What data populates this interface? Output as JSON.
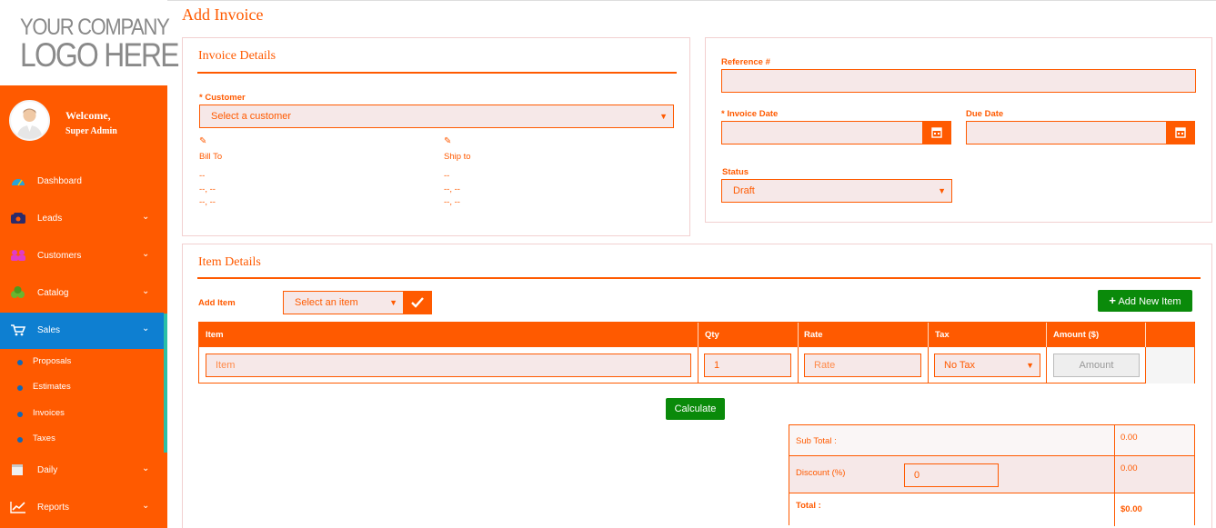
{
  "logo": {
    "line1": "YOUR COMPANY",
    "line2": "LOGO HERE"
  },
  "profile": {
    "welcome": "Welcome,",
    "name": "Super Admin"
  },
  "sidebar": {
    "items": [
      {
        "label": "Dashboard",
        "icon": "dashboard-icon"
      },
      {
        "label": "Leads",
        "icon": "phone-icon"
      },
      {
        "label": "Customers",
        "icon": "users-icon"
      },
      {
        "label": "Catalog",
        "icon": "catalog-icon"
      },
      {
        "label": "Sales",
        "icon": "cart-icon"
      },
      {
        "label": "Daily",
        "icon": "calendar-icon"
      },
      {
        "label": "Reports",
        "icon": "chart-line-icon"
      }
    ],
    "sales_sub": [
      {
        "label": "Proposals"
      },
      {
        "label": "Estimates"
      },
      {
        "label": "Invoices"
      },
      {
        "label": "Taxes"
      }
    ]
  },
  "page": {
    "title": "Add Invoice"
  },
  "invoice_details": {
    "title": "Invoice Details",
    "customer_label": "* Customer",
    "customer_placeholder": "Select a customer",
    "bill_to_label": "Bill To",
    "ship_to_label": "Ship to",
    "bill_lines": [
      "--",
      "--, --",
      "--, --"
    ],
    "ship_lines": [
      "--",
      "--, --",
      "--, --"
    ]
  },
  "invoice_meta": {
    "reference_label": "Reference #",
    "reference_value": "",
    "invoice_date_label": "* Invoice Date",
    "due_date_label": "Due Date",
    "status_label": "Status",
    "status_value": "Draft"
  },
  "item_details": {
    "title": "Item Details",
    "add_item_label": "Add Item",
    "select_item_placeholder": "Select an item",
    "add_new_item_label": "Add New Item",
    "columns": [
      "Item",
      "Qty",
      "Rate",
      "Tax",
      "Amount ($)"
    ],
    "row": {
      "item_placeholder": "Item",
      "qty": "1",
      "rate_placeholder": "Rate",
      "tax": "No Tax",
      "amount_placeholder": "Amount"
    },
    "calculate_label": "Calculate"
  },
  "totals": {
    "subtotal_label": "Sub Total :",
    "subtotal_value": "0.00",
    "discount_label": "Discount (%)",
    "discount_input": "0",
    "discount_value": "0.00",
    "total_label": "Total :",
    "total_value": "$0.00"
  },
  "colors": {
    "accent": "#ff5a00",
    "active": "#0e7fd1",
    "green": "#0a8a0a",
    "field_bg": "#f6e8e8"
  }
}
